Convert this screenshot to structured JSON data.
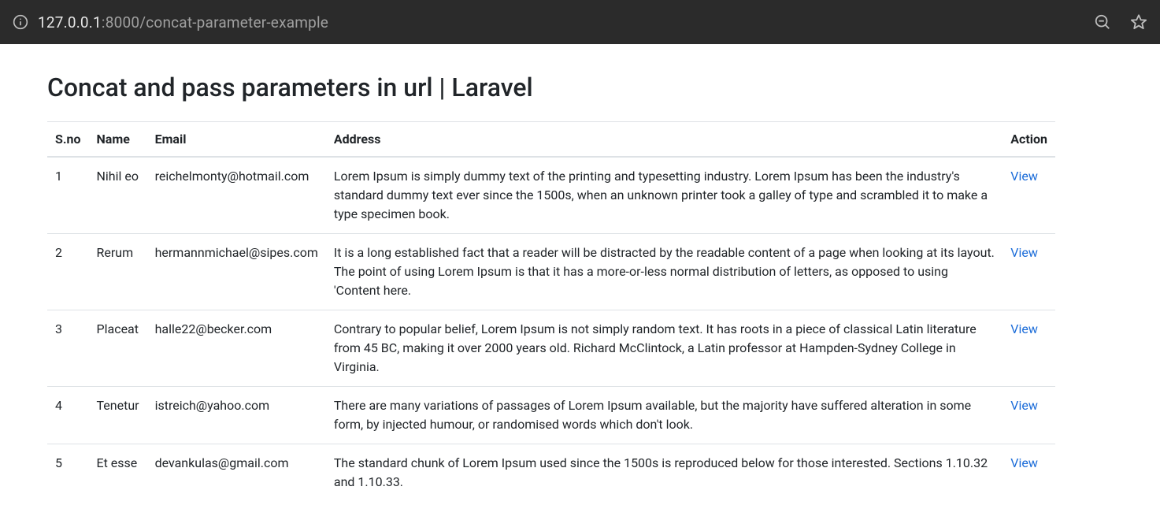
{
  "browser": {
    "url_primary": "127.0.0.1",
    "url_rest": ":8000/concat-parameter-example"
  },
  "page": {
    "title": "Concat and pass parameters in url | Laravel"
  },
  "table": {
    "headers": {
      "sno": "S.no",
      "name": "Name",
      "email": "Email",
      "address": "Address",
      "action": "Action"
    },
    "action_label": "View",
    "rows": [
      {
        "sno": "1",
        "name": "Nihil eo",
        "email": "reichelmonty@hotmail.com",
        "address": "Lorem Ipsum is simply dummy text of the printing and typesetting industry. Lorem Ipsum has been the industry's standard dummy text ever since the 1500s, when an unknown printer took a galley of type and scrambled it to make a type specimen book."
      },
      {
        "sno": "2",
        "name": "Rerum",
        "email": "hermannmichael@sipes.com",
        "address": "It is a long established fact that a reader will be distracted by the readable content of a page when looking at its layout. The point of using Lorem Ipsum is that it has a more-or-less normal distribution of letters, as opposed to using 'Content here."
      },
      {
        "sno": "3",
        "name": "Placeat",
        "email": "halle22@becker.com",
        "address": "Contrary to popular belief, Lorem Ipsum is not simply random text. It has roots in a piece of classical Latin literature from 45 BC, making it over 2000 years old. Richard McClintock, a Latin professor at Hampden-Sydney College in Virginia."
      },
      {
        "sno": "4",
        "name": "Tenetur",
        "email": "istreich@yahoo.com",
        "address": "There are many variations of passages of Lorem Ipsum available, but the majority have suffered alteration in some form, by injected humour, or randomised words which don't look."
      },
      {
        "sno": "5",
        "name": "Et esse",
        "email": "devankulas@gmail.com",
        "address": "The standard chunk of Lorem Ipsum used since the 1500s is reproduced below for those interested. Sections 1.10.32 and 1.10.33."
      }
    ]
  }
}
